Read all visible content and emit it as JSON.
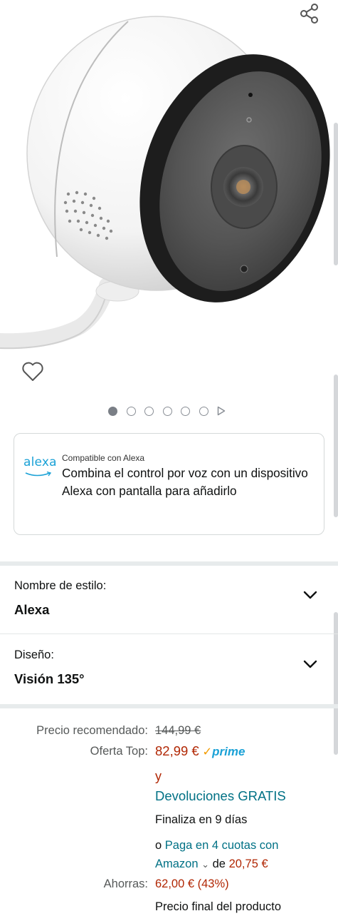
{
  "product_image": {
    "alt": "D-Link outdoor camera",
    "icon": "camera-product-image"
  },
  "icons": {
    "share": "share-icon",
    "wishlist": "heart-icon",
    "video": "play-icon",
    "dropdown": "chevron-down-icon"
  },
  "carousel": {
    "total_dots": 6,
    "active_index": 0
  },
  "alexa": {
    "logo_text": "alexa",
    "compat_label": "Compatible con Alexa",
    "description": "Combina el control por voz con un dispositivo Alexa con pantalla para añadirlo",
    "accent_color": "#1aa1d6"
  },
  "options": {
    "style": {
      "label": "Nombre de estilo:",
      "value": "Alexa"
    },
    "design": {
      "label": "Diseño:",
      "value": "Visión 135°"
    }
  },
  "pricing": {
    "recommended_label": "Precio recomendado:",
    "recommended_value": "144,99 €",
    "deal_label": "Oferta Top:",
    "deal_value": "82,99 €",
    "prime_check": "✓",
    "prime_text": "prime",
    "y_text": "y",
    "returns_text": "Devoluciones GRATIS",
    "ends_text": "Finaliza en 9 días",
    "installments_prefix": "o",
    "installments_link": "Paga en 4 cuotas con Amazon",
    "installments_de": "de",
    "installments_amount": "20,75 €",
    "savings_label": "Ahorras:",
    "savings_value": "62,00 € (43%)",
    "final_price_text": "Precio final del producto"
  },
  "colors": {
    "price_red": "#b12704",
    "link_teal": "#007185",
    "prime_blue": "#1aa1d6",
    "prime_orange": "#f29b00"
  }
}
